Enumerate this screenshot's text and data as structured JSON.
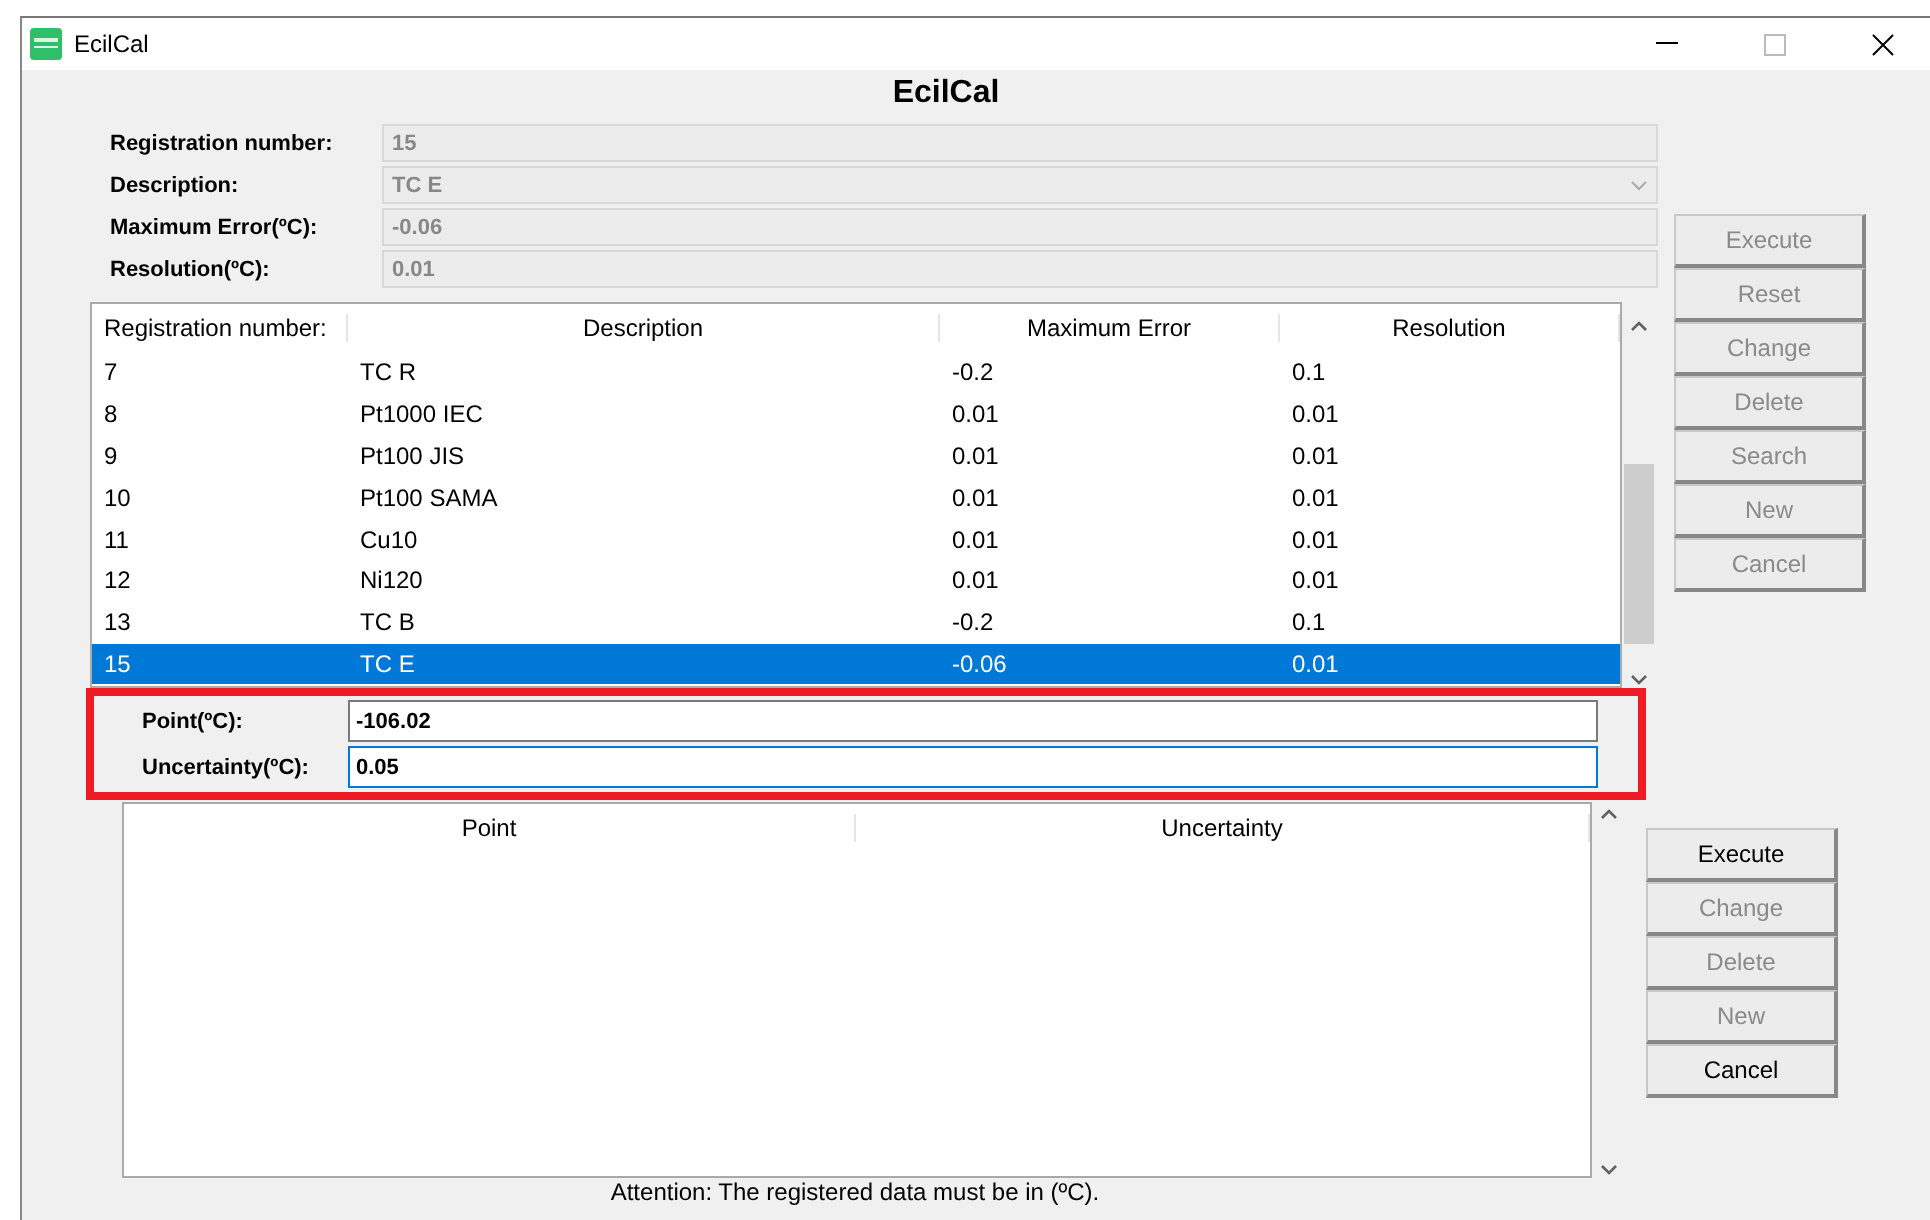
{
  "window": {
    "title": "EcilCal"
  },
  "heading": "EcilCal",
  "form": [
    {
      "label": "Registration number:",
      "value": "15",
      "kind": "text",
      "disabled": true
    },
    {
      "label": "Description:",
      "value": "TC E",
      "kind": "dropdown",
      "disabled": true
    },
    {
      "label": "Maximum Error(ºC):",
      "value": "-0.06",
      "kind": "text",
      "disabled": true
    },
    {
      "label": "Resolution(ºC):",
      "value": "0.01",
      "kind": "text",
      "disabled": true
    }
  ],
  "sensor_buttons": [
    {
      "label": "Execute",
      "disabled": true
    },
    {
      "label": "Reset",
      "disabled": true
    },
    {
      "label": "Change",
      "disabled": true
    },
    {
      "label": "Delete",
      "disabled": true
    },
    {
      "label": "Search",
      "disabled": true
    },
    {
      "label": "New",
      "disabled": true
    },
    {
      "label": "Cancel",
      "disabled": true
    }
  ],
  "sensor_table": {
    "columns": [
      "Registration number:",
      "Description",
      "Maximum Error",
      "Resolution"
    ],
    "rows": [
      {
        "cells": [
          "7",
          "TC R",
          "-0.2",
          "0.1"
        ],
        "selected": false
      },
      {
        "cells": [
          "8",
          "Pt1000 IEC",
          "0.01",
          "0.01"
        ],
        "selected": false
      },
      {
        "cells": [
          "9",
          "Pt100 JIS",
          "0.01",
          "0.01"
        ],
        "selected": false
      },
      {
        "cells": [
          "10",
          "Pt100 SAMA",
          "0.01",
          "0.01"
        ],
        "selected": false
      },
      {
        "cells": [
          "11",
          "Cu10",
          "0.01",
          "0.01"
        ],
        "selected": false
      },
      {
        "cells": [
          "12",
          "Ni120",
          "0.01",
          "0.01"
        ],
        "selected": false
      },
      {
        "cells": [
          "13",
          "TC B",
          "-0.2",
          "0.1"
        ],
        "selected": false
      },
      {
        "cells": [
          "15",
          "TC E",
          "-0.06",
          "0.01"
        ],
        "selected": true
      }
    ]
  },
  "point_form": [
    {
      "label": "Point(ºC):",
      "value": "-106.02",
      "focused": false
    },
    {
      "label": "Uncertainty(ºC):",
      "value": "0.05",
      "focused": true
    }
  ],
  "point_table": {
    "columns": [
      "Point",
      "Uncertainty"
    ]
  },
  "point_buttons": [
    {
      "label": "Execute",
      "disabled": false
    },
    {
      "label": "Change",
      "disabled": true
    },
    {
      "label": "Delete",
      "disabled": true
    },
    {
      "label": "New",
      "disabled": true
    },
    {
      "label": "Cancel",
      "disabled": false
    }
  ],
  "note": "Attention: The registered data must be in (ºC)."
}
